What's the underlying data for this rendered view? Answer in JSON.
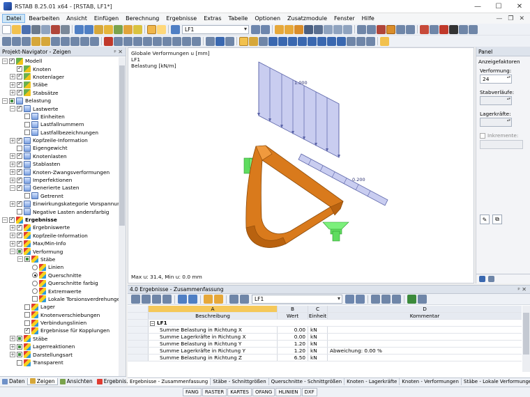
{
  "titlebar": {
    "title": "RSTAB 8.25.01 x64 - [RSTAB, LF1*]",
    "min": "—",
    "max": "☐",
    "close": "✕"
  },
  "menubar": {
    "items": [
      "Datei",
      "Bearbeiten",
      "Ansicht",
      "Einfügen",
      "Berechnung",
      "Ergebnisse",
      "Extras",
      "Tabelle",
      "Optionen",
      "Zusatzmodule",
      "Fenster",
      "Hilfe"
    ],
    "mdi_min": "—",
    "mdi_restore": "❐",
    "mdi_close": "✕"
  },
  "toolbar": {
    "loadcase": "LF1"
  },
  "navigator": {
    "title": "Projekt-Navigator - Zeigen",
    "pin": "ᵖ ✕",
    "items": [
      {
        "level": 0,
        "exp": "−",
        "cb": "on",
        "icon": "model",
        "label": "Modell"
      },
      {
        "level": 1,
        "exp": "",
        "cb": "on",
        "icon": "model",
        "label": "Knoten"
      },
      {
        "level": 1,
        "exp": "+",
        "cb": "on",
        "icon": "model",
        "label": "Knotenlager"
      },
      {
        "level": 1,
        "exp": "+",
        "cb": "on",
        "icon": "model",
        "label": "Stäbe"
      },
      {
        "level": 1,
        "exp": "+",
        "cb": "on",
        "icon": "model",
        "label": "Stabsätze"
      },
      {
        "level": 0,
        "exp": "−",
        "cb": "part",
        "icon": "load",
        "label": "Belastung"
      },
      {
        "level": 1,
        "exp": "−",
        "cb": "on",
        "icon": "load",
        "label": "Lastwerte"
      },
      {
        "level": 2,
        "exp": "",
        "cb": "off",
        "icon": "load",
        "label": "Einheiten"
      },
      {
        "level": 2,
        "exp": "",
        "cb": "off",
        "icon": "load",
        "label": "Lastfallnummern"
      },
      {
        "level": 2,
        "exp": "",
        "cb": "off",
        "icon": "load",
        "label": "Lastfallbezeichnungen"
      },
      {
        "level": 1,
        "exp": "+",
        "cb": "on",
        "icon": "load",
        "label": "Kopfzeile-Information"
      },
      {
        "level": 1,
        "exp": "",
        "cb": "off",
        "icon": "load",
        "label": "Eigengewicht"
      },
      {
        "level": 1,
        "exp": "+",
        "cb": "on",
        "icon": "load",
        "label": "Knotenlasten"
      },
      {
        "level": 1,
        "exp": "+",
        "cb": "on",
        "icon": "load",
        "label": "Stablasten"
      },
      {
        "level": 1,
        "exp": "+",
        "cb": "on",
        "icon": "load",
        "label": "Knoten-Zwangsverformungen"
      },
      {
        "level": 1,
        "exp": "+",
        "cb": "on",
        "icon": "load",
        "label": "Imperfektionen"
      },
      {
        "level": 1,
        "exp": "−",
        "cb": "on",
        "icon": "load",
        "label": "Generierte Lasten"
      },
      {
        "level": 2,
        "exp": "",
        "cb": "off",
        "icon": "load",
        "label": "Getrennt"
      },
      {
        "level": 1,
        "exp": "+",
        "cb": "on",
        "icon": "load",
        "label": "Einwirkungskategorie Vorspannung"
      },
      {
        "level": 1,
        "exp": "",
        "cb": "off",
        "icon": "load",
        "label": "Negative Lasten andersfarbig"
      },
      {
        "level": 0,
        "exp": "−",
        "cb": "on",
        "icon": "res",
        "label": "Ergebnisse",
        "bold": true
      },
      {
        "level": 1,
        "exp": "+",
        "cb": "on",
        "icon": "res",
        "label": "Ergebniswerte"
      },
      {
        "level": 1,
        "exp": "+",
        "cb": "on",
        "icon": "res",
        "label": "Kopfzeile-Information"
      },
      {
        "level": 1,
        "exp": "+",
        "cb": "on",
        "icon": "res",
        "label": "Max/Min-Info"
      },
      {
        "level": 1,
        "exp": "−",
        "cb": "part",
        "icon": "res",
        "label": "Verformung"
      },
      {
        "level": 2,
        "exp": "−",
        "cb": "part",
        "icon": "res",
        "label": "Stäbe"
      },
      {
        "level": 3,
        "exp": "",
        "rad": "off",
        "icon": "res",
        "label": "Linien"
      },
      {
        "level": 3,
        "exp": "",
        "rad": "on",
        "icon": "res",
        "label": "Querschnitte"
      },
      {
        "level": 3,
        "exp": "",
        "rad": "off",
        "icon": "res",
        "label": "Querschnitte farbig"
      },
      {
        "level": 3,
        "exp": "",
        "rad": "off",
        "icon": "res",
        "label": "Extremwerte"
      },
      {
        "level": 3,
        "exp": "",
        "cb": "off",
        "icon": "res",
        "label": "Lokale Torsionsverdrehungen"
      },
      {
        "level": 2,
        "exp": "",
        "cb": "off",
        "icon": "res",
        "label": "Lager"
      },
      {
        "level": 2,
        "exp": "",
        "cb": "off",
        "icon": "res",
        "label": "Knotenverschiebungen"
      },
      {
        "level": 2,
        "exp": "",
        "cb": "off",
        "icon": "res",
        "label": "Verbindungslinien"
      },
      {
        "level": 2,
        "exp": "",
        "cb": "on",
        "icon": "res",
        "label": "Ergebnisse für Kopplungen"
      },
      {
        "level": 1,
        "exp": "+",
        "cb": "part",
        "icon": "res",
        "label": "Stäbe"
      },
      {
        "level": 1,
        "exp": "+",
        "cb": "part",
        "icon": "res",
        "label": "Lagerreaktionen"
      },
      {
        "level": 1,
        "exp": "+",
        "cb": "part",
        "icon": "res",
        "label": "Darstellungsart"
      },
      {
        "level": 1,
        "exp": "",
        "cb": "off",
        "icon": "res",
        "label": "Transparent"
      }
    ],
    "tabs": [
      "Daten",
      "Zeigen",
      "Ansichten",
      "Ergebnis..."
    ]
  },
  "view": {
    "header": [
      "Globale Verformungen u [mm]",
      "LF1",
      "Belastung [kN/m]"
    ],
    "load_label_1": "1.000",
    "load_label_2": "0.200",
    "footer": "Max u: 31.4, Min u: 0.0 mm"
  },
  "panel": {
    "title": "Panel",
    "section": "Anzeigefaktoren",
    "deformation_label": "Verformung:",
    "deformation_value": "24",
    "member_label": "Stabverläufe:",
    "support_label": "Lagerkräfte:",
    "increments_label": "Inkremente:"
  },
  "results": {
    "title": "4.0 Ergebnisse - Zusammenfassung",
    "loadcase": "LF1",
    "columns": {
      "a": "A",
      "a_sub": "Beschreibung",
      "b": "B",
      "b_sub": "Wert",
      "c": "C",
      "c_sub": "Einheit",
      "d": "D",
      "d_sub": "Kommentar"
    },
    "group": "LF1",
    "rows": [
      {
        "desc": "Summe Belastung in Richtung X",
        "value": "0.00",
        "unit": "kN",
        "comment": ""
      },
      {
        "desc": "Summe Lagerkräfte in Richtung X",
        "value": "0.00",
        "unit": "kN",
        "comment": ""
      },
      {
        "desc": "Summe Belastung in Richtung Y",
        "value": "1.20",
        "unit": "kN",
        "comment": ""
      },
      {
        "desc": "Summe Lagerkräfte in Richtung Y",
        "value": "1.20",
        "unit": "kN",
        "comment": "Abweichung:  0.00 %"
      },
      {
        "desc": "Summe Belastung in Richtung Z",
        "value": "6.50",
        "unit": "kN",
        "comment": ""
      }
    ],
    "tabs": [
      "Ergebnisse - Zusammenfassung",
      "Stäbe - Schnittgrößen",
      "Querschnitte - Schnittgrößen",
      "Knoten - Lagerkräfte",
      "Knoten - Verformungen",
      "Stäbe - Lokale Verformungen"
    ]
  },
  "statusbar": {
    "buttons": [
      "FANG",
      "RASTER",
      "KARTES",
      "OFANG",
      "HLINIEN",
      "DXF"
    ]
  }
}
